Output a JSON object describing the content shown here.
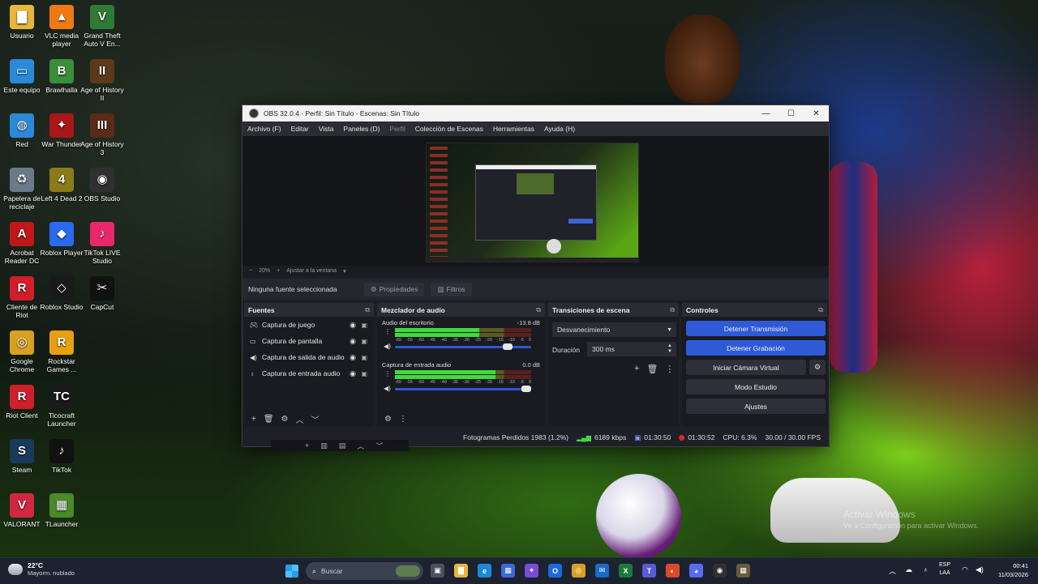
{
  "desktop": {
    "icons": [
      {
        "label": "Usuario",
        "glyph": "▇",
        "color": "#e8b63a"
      },
      {
        "label": "VLC media player",
        "glyph": "▲",
        "color": "#f07a12"
      },
      {
        "label": "Grand Theft Auto V En...",
        "glyph": "V",
        "color": "#2f7a36"
      },
      {
        "label": "Este equipo",
        "glyph": "▭",
        "color": "#2a8ad8"
      },
      {
        "label": "Brawlhalla",
        "glyph": "B",
        "color": "#3a8f3a"
      },
      {
        "label": "Age of History II",
        "glyph": "II",
        "color": "#5a3a1a"
      },
      {
        "label": "Red",
        "glyph": "◍",
        "color": "#2a8ad8"
      },
      {
        "label": "War Thunder",
        "glyph": "✦",
        "color": "#a81818"
      },
      {
        "label": "Age of History 3",
        "glyph": "III",
        "color": "#5a2a1a"
      },
      {
        "label": "Papelera de reciclaje",
        "glyph": "♻",
        "color": "#6a7a8a"
      },
      {
        "label": "Left 4 Dead 2",
        "glyph": "4",
        "color": "#8a7a1a"
      },
      {
        "label": "OBS Studio",
        "glyph": "◉",
        "color": "#303030"
      },
      {
        "label": "Acrobat Reader DC",
        "glyph": "A",
        "color": "#c01818"
      },
      {
        "label": "Roblox Player",
        "glyph": "◆",
        "color": "#2a6af0"
      },
      {
        "label": "TikTok LIVE Studio",
        "glyph": "♪",
        "color": "#e8286a"
      },
      {
        "label": "Cliente de Riot",
        "glyph": "R",
        "color": "#d01e2a"
      },
      {
        "label": "Roblox Studio",
        "glyph": "◇",
        "color": "#1a1a1a"
      },
      {
        "label": "CapCut",
        "glyph": "✂",
        "color": "#111111"
      },
      {
        "label": "Google Chrome",
        "glyph": "◎",
        "color": "#d8a020"
      },
      {
        "label": "Rockstar Games ...",
        "glyph": "R",
        "color": "#e8a010"
      },
      {
        "label": "Riot Client",
        "glyph": "R",
        "color": "#d01e2a"
      },
      {
        "label": "Ticocraft Launcher",
        "glyph": "TC",
        "color": "#1a1a1a"
      },
      {
        "label": "Steam",
        "glyph": "S",
        "color": "#1a3a5a"
      },
      {
        "label": "TikTok",
        "glyph": "♪",
        "color": "#111111"
      },
      {
        "label": "VALORANT",
        "glyph": "V",
        "color": "#d02840"
      },
      {
        "label": "TLauncher",
        "glyph": "▦",
        "color": "#4a8a2a"
      }
    ],
    "watermark_title": "Activar Windows",
    "watermark_sub": "Ve a Configuración para activar Windows."
  },
  "obs": {
    "title": "OBS 32.0.4 - Perfil: Sin Título - Escenas: Sin Título",
    "window_buttons": [
      "—",
      "☐",
      "✕"
    ],
    "menu": [
      {
        "label": "Archivo (F)",
        "enabled": true
      },
      {
        "label": "Editar",
        "enabled": true
      },
      {
        "label": "Vista",
        "enabled": true
      },
      {
        "label": "Paneles (D)",
        "enabled": true
      },
      {
        "label": "Perfil",
        "enabled": false
      },
      {
        "label": "Colección de Escenas",
        "enabled": true
      },
      {
        "label": "Herramientas",
        "enabled": true
      },
      {
        "label": "Ayuda (H)",
        "enabled": true
      }
    ],
    "zoom": {
      "minus": "−",
      "value": "20%",
      "plus": "+",
      "fit_label": "Ajustar a la ventana"
    },
    "source_toolbar": {
      "no_source": "Ninguna fuente seleccionada",
      "properties": "Propiedades",
      "filters": "Filtros"
    },
    "sources": {
      "title": "Fuentes",
      "items": [
        {
          "label": "Captura de juego",
          "icon": "gamepad-icon"
        },
        {
          "label": "Captura de pantalla",
          "icon": "monitor-icon"
        },
        {
          "label": "Captura de salida de audio",
          "icon": "speaker-icon"
        },
        {
          "label": "Captura de entrada audio",
          "icon": "microphone-icon"
        }
      ]
    },
    "mixer": {
      "title": "Mezclador de audio",
      "tracks": [
        {
          "name": "Audio del escritorio",
          "db": "-13.8 dB",
          "level": 0.62,
          "volume": 0.85
        },
        {
          "name": "Captura de entrada audio",
          "db": "0.0 dB",
          "level": 0.74,
          "volume": 1.0
        }
      ],
      "scale": [
        "-60",
        "-55",
        "-50",
        "-45",
        "-40",
        "-35",
        "-30",
        "-25",
        "-20",
        "-15",
        "-10",
        "-5",
        "0"
      ]
    },
    "transitions": {
      "title": "Transiciones de escena",
      "selected": "Desvanecimiento",
      "duration_label": "Duración",
      "duration_value": "300 ms"
    },
    "controls": {
      "title": "Controles",
      "stop_stream": "Detener Transmisión",
      "stop_record": "Detener Grabación",
      "virtual_cam": "Iniciar Cámara Virtual",
      "studio_mode": "Modo Estudio",
      "settings": "Ajustes"
    },
    "status": {
      "dropped": "Fotogramas Perdidos 1983 (1.2%)",
      "bitrate": "6189 kbps",
      "stream_time": "01:30:50",
      "record_time": "01:30:52",
      "cpu": "CPU: 6.3%",
      "fps": "30.00 / 30.00 FPS"
    }
  },
  "taskbar": {
    "weather_temp": "22°C",
    "weather_cond": "Mayorm. nublado",
    "search_placeholder": "Buscar",
    "apps": [
      {
        "name": "task-view-icon",
        "glyph": "▣",
        "color": "#4a5060"
      },
      {
        "name": "file-explorer-icon",
        "glyph": "▇",
        "color": "#e8b63a"
      },
      {
        "name": "edge-icon",
        "glyph": "e",
        "color": "#1a8ad8"
      },
      {
        "name": "store-icon",
        "glyph": "▦",
        "color": "#3a6ad8"
      },
      {
        "name": "copilot-icon",
        "glyph": "✦",
        "color": "#7a4ad8"
      },
      {
        "name": "outlook-icon",
        "glyph": "O",
        "color": "#1a6ad8"
      },
      {
        "name": "chrome-icon",
        "glyph": "◎",
        "color": "#d8a020"
      },
      {
        "name": "mail-icon",
        "glyph": "✉",
        "color": "#1a6ac8"
      },
      {
        "name": "excel-icon",
        "glyph": "X",
        "color": "#1a7a3a"
      },
      {
        "name": "teams-icon",
        "glyph": "T",
        "color": "#5a5ad8"
      },
      {
        "name": "photos-icon",
        "glyph": "◐",
        "color": "#d84a2a"
      },
      {
        "name": "discord-icon",
        "glyph": "◕",
        "color": "#5a6af0"
      },
      {
        "name": "obs-taskbar-icon",
        "glyph": "◉",
        "color": "#303030"
      },
      {
        "name": "minecraft-icon",
        "glyph": "▦",
        "color": "#6a5a3a"
      }
    ],
    "lang_top": "ESP",
    "lang_bottom": "LAA",
    "time": "00:41",
    "date": "11/03/2026"
  }
}
